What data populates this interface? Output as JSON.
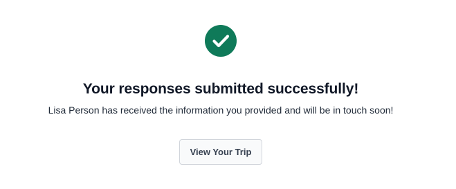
{
  "confirmation": {
    "icon": "check-circle-icon",
    "icon_color": "#0f7a59",
    "title": "Your responses submitted successfully!",
    "message": "Lisa Person has received the information you provided and will be in touch soon!",
    "button_label": "View Your Trip"
  }
}
